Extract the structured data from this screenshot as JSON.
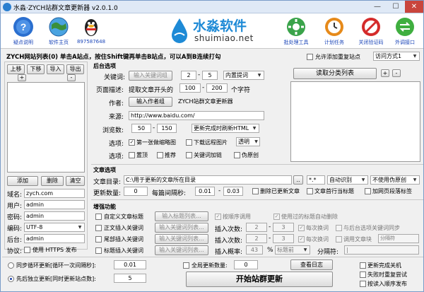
{
  "window": {
    "title": "水淼·ZYCH站群文章更新器 v2.0.1.0",
    "min": "—",
    "max": "☐",
    "close": "✕"
  },
  "header": {
    "left": [
      {
        "label": "疑点说明",
        "icon": "question-icon",
        "color": "#2b6fcf"
      },
      {
        "label": "软件主页",
        "icon": "globe-icon",
        "color": "#3a8f3a"
      },
      {
        "label": "897587648",
        "icon": "qq-penguin-icon",
        "color": "#222222"
      }
    ],
    "logo": {
      "name": "水淼软件",
      "url": "shuimiao.net"
    },
    "right": [
      {
        "label": "批处理工具",
        "icon": "gear-icon",
        "color": "#3aa34a"
      },
      {
        "label": "计划任务",
        "icon": "clock-icon",
        "color": "#e68a1a"
      },
      {
        "label": "关闭验证码",
        "icon": "no-entry-icon",
        "color": "#d42b2b"
      },
      {
        "label": "外调接口",
        "icon": "exchange-icon",
        "color": "#3fae3f"
      }
    ]
  },
  "top": {
    "hint": "ZYCH网站列表(0)  单击A站点，按住Shift键再单击B站点，可以A到B连续打勾",
    "allow_repeat": "允许添加重复站点",
    "access_mode": "访问方式1"
  },
  "site_list": {
    "buttons": [
      "上移",
      "下移",
      "导入",
      "导出"
    ],
    "plus": "+",
    "minus": "-",
    "actions": {
      "add": "添加",
      "delete": "删除",
      "clear": "清空"
    },
    "fields": [
      {
        "label": "域名:",
        "value": "zych.com"
      },
      {
        "label": "用户:",
        "value": "admin"
      },
      {
        "label": "密码:",
        "value": "admin"
      },
      {
        "label": "编码:",
        "value": "UTF-8"
      },
      {
        "label": "后台:",
        "value": "admin"
      }
    ],
    "protocol_label": "协议:",
    "https": "使用 HTTPS 发布"
  },
  "backend": {
    "title": "后台选项",
    "keyword_label": "关键词:",
    "keyword_btn": "输入关键词组",
    "keyword_from": "2",
    "keyword_to": "5",
    "keyword_sel": "内置提词",
    "desc_label": "页面描述:",
    "desc_text": "提取文章开头的",
    "desc_from": "100",
    "desc_to": "200",
    "desc_unit": "个字符",
    "author_label": "作者:",
    "author_btn": "输入作者组",
    "author_value": "ZYCH站群文章更新器",
    "source_label": "来源:",
    "source_value": "http://www.baidu.com/",
    "views_label": "浏览数:",
    "views_from": "50",
    "views_to": "150",
    "refresh_sel": "更新完成时刷新HTML",
    "opt_label": "选项:",
    "opt_first_thumb": "第一张做缩略图",
    "opt_download_remote": "下载远程图片",
    "transparent": "透明",
    "opt2_label": "选项:",
    "opt_top": "置顶",
    "opt_recommend": "推荐",
    "opt_keyword_link": "关键词加链",
    "opt_pseudo": "伪原创"
  },
  "read_list": {
    "button": "读取分类列表",
    "plus": "+",
    "minus": "-"
  },
  "article": {
    "title": "文章选项",
    "dir_label": "文章目录:",
    "dir_value": "C:\\用于更新的文章所在目录",
    "browse": "..",
    "ext": "*.*",
    "encoding": "自动识别",
    "pseudo_sel": "不使用伪原创",
    "count_label": "更新数量:",
    "count_value": "0",
    "interval_label": "每篇间隔秒:",
    "interval_from": "0.01",
    "interval_to": "0.03",
    "delete_updated": "删除已更新文章",
    "first_line_title": "文章首行当标题",
    "add_punct": "加网页段落标签"
  },
  "enhance": {
    "title": "增强功能",
    "row1": {
      "cb": "自定义文章标题",
      "btn": "输入标题列表...",
      "cb2": "按顺序调用",
      "cb3": "使用过的标题自动删除"
    },
    "row2": {
      "cb": "正文插入关键词",
      "btn": "输入关键词列表...",
      "times": "插入次数:",
      "from": "2",
      "to": "3",
      "change": "每次换词",
      "sync": "与后台选项关键词同步"
    },
    "row3": {
      "cb": "尾部插入关键词",
      "btn": "输入关键词列表...",
      "times": "插入次数:",
      "from": "2",
      "to": "3",
      "change": "每次换词",
      "lib": "调用文章块",
      "lib_ph": "分隔符"
    },
    "row4": {
      "cb": "标题插入关键词",
      "btn": "输入关键词列表...",
      "rate": "插入概率:",
      "rate_value": "43",
      "pct": "%",
      "pos": "标题前",
      "sep_label": "分隔符:",
      "sep_value": "|"
    }
  },
  "bottom": {
    "sync_loop": "同步循环更新[循环一次间隔秒]:",
    "sync_value": "0.01",
    "first_independent": "先后独立更新[同时更新站点数]:",
    "first_value": "5",
    "global_count": "全局更新数量:",
    "global_value": "0",
    "view_log": "查看日志",
    "start": "开始站群更新",
    "shutdown": "更新完成关机",
    "retry": "失败时重复尝试",
    "order_publish": "按读入顺序发布"
  }
}
